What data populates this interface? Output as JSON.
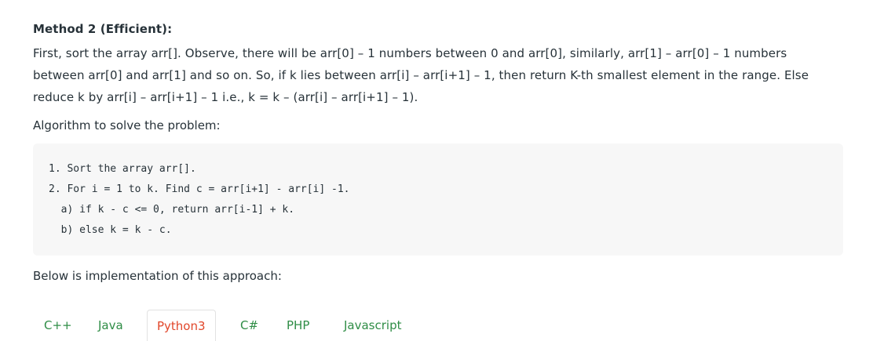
{
  "method": {
    "heading": "Method 2 (Efficient):",
    "paragraph_lines": [
      "First, sort the array arr[]. Observe, there will be arr[0] – 1 numbers between 0 and arr[0], similarly, arr[1] – arr[0] – 1 numbers",
      "between arr[0] and arr[1] and so on. So, if k lies between arr[i] – arr[i+1] – 1, then return K-th smallest element in the range. Else",
      "reduce k by arr[i] – arr[i+1] – 1 i.e., k = k – (arr[i] – arr[i+1] – 1)."
    ]
  },
  "algorithm": {
    "title": "Algorithm to solve the problem:",
    "code_lines": [
      "1. Sort the array arr[].",
      "2. For i = 1 to k. Find c = arr[i+1] - arr[i] -1.",
      "  a) if k - c <= 0, return arr[i-1] + k.",
      "  b) else k = k - c."
    ]
  },
  "implementation": {
    "title": "Below is implementation of this approach:"
  },
  "tabs": [
    {
      "label": "C++",
      "active": false
    },
    {
      "label": "Java",
      "active": false
    },
    {
      "label": "Python3",
      "active": true
    },
    {
      "label": "C#",
      "active": false
    },
    {
      "label": "PHP",
      "active": false
    },
    {
      "label": "Javascript",
      "active": false
    }
  ],
  "colors": {
    "text": "#273239",
    "tab_text": "#2f8d46",
    "active_tab_text": "#e1462a",
    "code_background": "#f7f7f7"
  }
}
